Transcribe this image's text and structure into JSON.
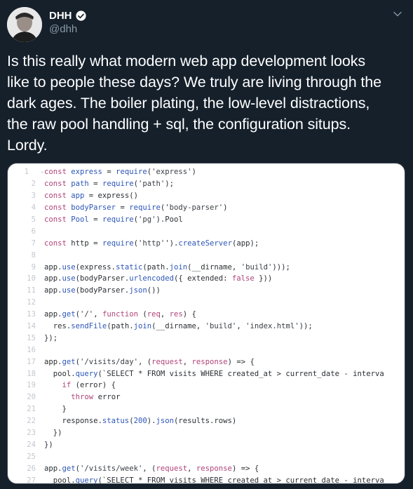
{
  "tweet": {
    "author": {
      "display_name": "DHH",
      "handle": "@dhh",
      "verified": true
    },
    "text_lines": [
      "Is this really what modern web app development looks",
      "like to people these days? We truly are living through the",
      "dark ages. The boiler plating, the low-level distractions,",
      "the raw pool handling + sql, the configuration situps.",
      "Lordy."
    ],
    "menu_icon": "chevron-down-icon"
  },
  "code_image": {
    "lines": [
      {
        "n": "1",
        "fold": true,
        "parts": [
          [
            "kw",
            "const "
          ],
          [
            "fn",
            "express"
          ],
          [
            "src",
            " = "
          ],
          [
            "fn",
            "require"
          ],
          [
            "src",
            "("
          ],
          [
            "str",
            "'express'"
          ],
          [
            "src",
            ")"
          ]
        ]
      },
      {
        "n": "2",
        "parts": [
          [
            "kw",
            "const "
          ],
          [
            "fn",
            "path"
          ],
          [
            "src",
            " = "
          ],
          [
            "fn",
            "require"
          ],
          [
            "src",
            "("
          ],
          [
            "str",
            "'path'"
          ],
          [
            "src",
            ");"
          ]
        ]
      },
      {
        "n": "3",
        "parts": [
          [
            "kw",
            "const "
          ],
          [
            "fn",
            "app"
          ],
          [
            "src",
            " = express()"
          ]
        ]
      },
      {
        "n": "4",
        "parts": [
          [
            "kw",
            "const "
          ],
          [
            "fn",
            "bodyParser"
          ],
          [
            "src",
            " = "
          ],
          [
            "fn",
            "require"
          ],
          [
            "src",
            "("
          ],
          [
            "str",
            "'body-parser'"
          ],
          [
            "src",
            ")"
          ]
        ]
      },
      {
        "n": "5",
        "parts": [
          [
            "kw",
            "const "
          ],
          [
            "fn",
            "Pool"
          ],
          [
            "src",
            " = "
          ],
          [
            "fn",
            "require"
          ],
          [
            "src",
            "("
          ],
          [
            "str",
            "'pg'"
          ],
          [
            "src",
            ").Pool"
          ]
        ]
      },
      {
        "n": "6",
        "parts": []
      },
      {
        "n": "7",
        "parts": [
          [
            "kw",
            "const "
          ],
          [
            "src",
            "http = "
          ],
          [
            "fn",
            "require"
          ],
          [
            "src",
            "("
          ],
          [
            "str",
            "'http'"
          ],
          [
            "src",
            "')."
          ],
          [
            "fn",
            "createServer"
          ],
          [
            "src",
            "(app);"
          ]
        ]
      },
      {
        "n": "8",
        "parts": []
      },
      {
        "n": "9",
        "parts": [
          [
            "src",
            "app."
          ],
          [
            "fn",
            "use"
          ],
          [
            "src",
            "(express."
          ],
          [
            "fn",
            "static"
          ],
          [
            "src",
            "(path."
          ],
          [
            "fn",
            "join"
          ],
          [
            "src",
            "(__dirname, "
          ],
          [
            "str",
            "'build'"
          ],
          [
            "src",
            ")));"
          ]
        ]
      },
      {
        "n": "10",
        "parts": [
          [
            "src",
            "app."
          ],
          [
            "fn",
            "use"
          ],
          [
            "src",
            "(bodyParser."
          ],
          [
            "fn",
            "urlencoded"
          ],
          [
            "src",
            "({ extended: "
          ],
          [
            "kw",
            "false"
          ],
          [
            "src",
            " }))"
          ]
        ]
      },
      {
        "n": "11",
        "parts": [
          [
            "src",
            "app."
          ],
          [
            "fn",
            "use"
          ],
          [
            "src",
            "(bodyParser."
          ],
          [
            "fn",
            "json"
          ],
          [
            "src",
            "())"
          ]
        ]
      },
      {
        "n": "12",
        "parts": []
      },
      {
        "n": "13",
        "parts": [
          [
            "src",
            "app."
          ],
          [
            "fn",
            "get"
          ],
          [
            "src",
            "("
          ],
          [
            "str",
            "'/'"
          ],
          [
            "src",
            ", "
          ],
          [
            "kw",
            "function "
          ],
          [
            "src",
            "("
          ],
          [
            "prm",
            "req"
          ],
          [
            "src",
            ", "
          ],
          [
            "prm",
            "res"
          ],
          [
            "src",
            ") {"
          ]
        ]
      },
      {
        "n": "14",
        "parts": [
          [
            "src",
            "  res."
          ],
          [
            "fn",
            "sendFile"
          ],
          [
            "src",
            "(path."
          ],
          [
            "fn",
            "join"
          ],
          [
            "src",
            "(__dirname, "
          ],
          [
            "str",
            "'build'"
          ],
          [
            "src",
            ", "
          ],
          [
            "str",
            "'index.html'"
          ],
          [
            "src",
            "));"
          ]
        ]
      },
      {
        "n": "15",
        "parts": [
          [
            "src",
            "});"
          ]
        ]
      },
      {
        "n": "16",
        "parts": []
      },
      {
        "n": "17",
        "parts": [
          [
            "src",
            "app."
          ],
          [
            "fn",
            "get"
          ],
          [
            "src",
            "("
          ],
          [
            "str",
            "'/visits/day'"
          ],
          [
            "src",
            ", ("
          ],
          [
            "prm",
            "request"
          ],
          [
            "src",
            ", "
          ],
          [
            "prm",
            "response"
          ],
          [
            "src",
            ") => {"
          ]
        ]
      },
      {
        "n": "18",
        "parts": [
          [
            "src",
            "  pool."
          ],
          [
            "fn",
            "query"
          ],
          [
            "src",
            "(`SELECT * FROM visits WHERE created_at > current_date - interva"
          ]
        ]
      },
      {
        "n": "19",
        "parts": [
          [
            "src",
            "    "
          ],
          [
            "kw",
            "if "
          ],
          [
            "src",
            "(error) {"
          ]
        ]
      },
      {
        "n": "20",
        "parts": [
          [
            "src",
            "      "
          ],
          [
            "kw",
            "throw "
          ],
          [
            "src",
            "error"
          ]
        ]
      },
      {
        "n": "21",
        "parts": [
          [
            "src",
            "    }"
          ]
        ]
      },
      {
        "n": "22",
        "parts": [
          [
            "src",
            "    response."
          ],
          [
            "fn",
            "status"
          ],
          [
            "src",
            "("
          ],
          [
            "num",
            "200"
          ],
          [
            "src",
            ")."
          ],
          [
            "fn",
            "json"
          ],
          [
            "src",
            "(results.rows)"
          ]
        ]
      },
      {
        "n": "23",
        "parts": [
          [
            "src",
            "  })"
          ]
        ]
      },
      {
        "n": "24",
        "parts": [
          [
            "src",
            "})"
          ]
        ]
      },
      {
        "n": "25",
        "parts": []
      },
      {
        "n": "26",
        "parts": [
          [
            "src",
            "app."
          ],
          [
            "fn",
            "get"
          ],
          [
            "src",
            "("
          ],
          [
            "str",
            "'/visits/week'"
          ],
          [
            "src",
            ", ("
          ],
          [
            "prm",
            "request"
          ],
          [
            "src",
            ", "
          ],
          [
            "prm",
            "response"
          ],
          [
            "src",
            ") => {"
          ]
        ]
      },
      {
        "n": "27",
        "parts": [
          [
            "src",
            "  pool."
          ],
          [
            "fn",
            "query"
          ],
          [
            "src",
            "(`SELECT * FROM visits WHERE created_at > current_date - interva"
          ]
        ]
      }
    ]
  }
}
